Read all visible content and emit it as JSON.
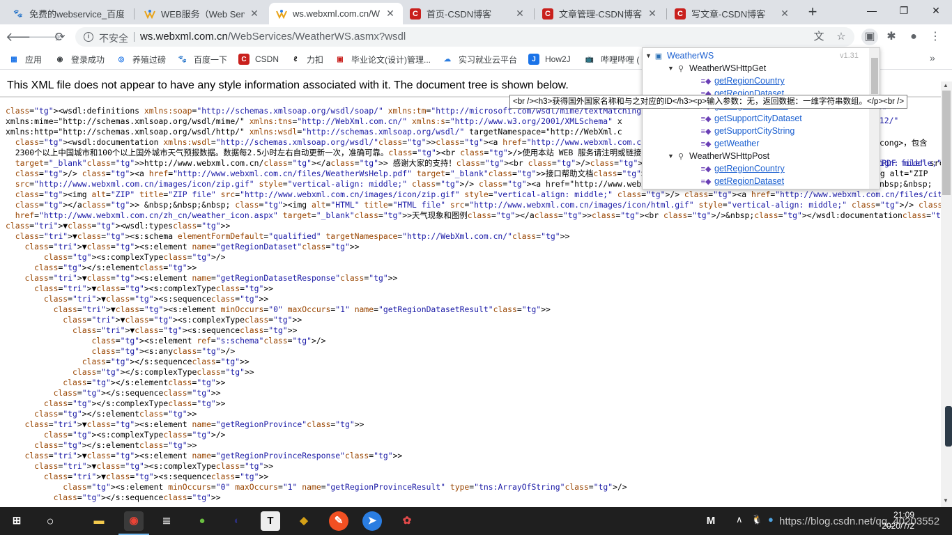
{
  "tabs": [
    {
      "label": "免费的webservice_百度",
      "icon": "baidu-paw-icon",
      "active": false
    },
    {
      "label": "WEB服务（Web Servic",
      "icon": "webxml-icon",
      "active": false
    },
    {
      "label": "ws.webxml.com.cn/W",
      "icon": "webxml-icon",
      "active": true
    },
    {
      "label": "首页-CSDN博客",
      "icon": "csdn-icon",
      "active": false
    },
    {
      "label": "文章管理-CSDN博客",
      "icon": "csdn-icon",
      "active": false
    },
    {
      "label": "写文章-CSDN博客",
      "icon": "csdn-icon",
      "active": false
    }
  ],
  "newtab": "+",
  "window": {
    "minimize": "—",
    "restore": "❐",
    "close": "✕"
  },
  "toolbar": {
    "security_label": "不安全",
    "url_host": "ws.webxml.com.cn",
    "url_path": "/WebServices/WeatherWS.asmx?wsdl"
  },
  "bookmarks": [
    {
      "label": "应用",
      "icon": "apps-grid-icon"
    },
    {
      "label": "登录成功",
      "icon": "globe-icon"
    },
    {
      "label": "养殖过磅",
      "icon": "chrome-icon"
    },
    {
      "label": "百度一下",
      "icon": "baidu-paw-icon"
    },
    {
      "label": "CSDN",
      "icon": "csdn-icon"
    },
    {
      "label": "力扣",
      "icon": "leetcode-icon"
    },
    {
      "label": "毕业论文(设计)管理...",
      "icon": "paper-icon"
    },
    {
      "label": "实习就业云平台",
      "icon": "cloud-icon"
    },
    {
      "label": "How2J",
      "icon": "how2j-icon"
    },
    {
      "label": "哔哩哔哩 (",
      "icon": "bilibili-icon"
    }
  ],
  "notice": "This XML file does not appear to have any style information associated with it. The document tree is shown below.",
  "xml_lines": [
    "<wsdl:definitions xmlns:soap=\"http://schemas.xmlsoap.org/wsdl/soap/\" xmlns:tm=\"http://microsoft.com/wsdl/mime/textMatching/\" xmln",
    "xmlns:mime=\"http://schemas.xmlsoap.org/wsdl/mime/\" xmlns:tns=\"http://WebXml.com.cn/\" xmlns:s=\"http://www.w3.org/2001/XMLSchema\" x",
    "xmlns:http=\"http://schemas.xmlsoap.org/wsdl/http/\" xmlns:wsdl=\"http://schemas.xmlsoap.org/wsdl/\" targetNamespace=\"http://WebXml.c",
    "  <wsdl:documentation xmlns:wsdl=\"http://schemas.xmlsoap.org/wsdl/\"><a href=\"http://www.webxml.com.cn/\" target=\"_blank\">WebXml.co",
    "  2300个以上中国城市和100个以上国外城市天气预报数据。数据每2.5小时左右自动更新一次，准确可靠。<br />使用本站 WEB 服务请注明或链接",
    "  target=\"_blank\">http://www.webxml.com.cn/</a> 感谢大家的支持！<br /><br /><img alt=\"PDF\" title=\"PDF file\" src=\"http://www.webxm",
    "  /> <a href=\"http://www.webxml.com.cn/files/WeatherWsHelp.pdf\" target=\"_blank\">接口帮助文档</a> &nbsp;&nbsp;&nbsp; <img alt=\"ZIP",
    "  src=\"http://www.webxml.com.cn/images/icon/zip.gif\" style=\"vertical-align: middle;\" /> <a href=\"http://www.webxml.com.cn/files/a",
    "  <img alt=\"ZIP\" title=\"ZIP file\" src=\"http://www.webxml.com.cn/images/icon/zip.gif\" style=\"vertical-align: middle;\" /> <a href=\"http://www.webxml.com.cn/files/city_photo.zip\">部分城市图片",
    "  </a> &nbsp;&nbsp;&nbsp; <img alt=\"HTML\" title=\"HTML file\" src=\"http://www.webxml.com.cn/images/icon/html.gif\" style=\"vertical-align: middle;\" /> <a",
    "  href=\"http://www.webxml.com.cn/zh_cn/weather_icon.aspx\" target=\"_blank\">天气现象和图例</a><br />&nbsp;</wsdl:documentation>",
    "▼<wsdl:types>",
    "  ▼<s:schema elementFormDefault=\"qualified\" targetNamespace=\"http://WebXml.com.cn/\">",
    "    ▼<s:element name=\"getRegionDataset\">",
    "        <s:complexType/>",
    "      </s:element>",
    "    ▼<s:element name=\"getRegionDatasetResponse\">",
    "      ▼<s:complexType>",
    "        ▼<s:sequence>",
    "          ▼<s:element minOccurs=\"0\" maxOccurs=\"1\" name=\"getRegionDatasetResult\">",
    "            ▼<s:complexType>",
    "              ▼<s:sequence>",
    "                  <s:element ref=\"s:schema\"/>",
    "                  <s:any/>",
    "                </s:sequence>",
    "              </s:complexType>",
    "            </s:element>",
    "          </s:sequence>",
    "        </s:complexType>",
    "      </s:element>",
    "    ▼<s:element name=\"getRegionProvince\">",
    "        <s:complexType/>",
    "      </s:element>",
    "    ▼<s:element name=\"getRegionProvinceResponse\">",
    "      ▼<s:complexType>",
    "        ▼<s:sequence>",
    "            <s:element minOccurs=\"0\" maxOccurs=\"1\" name=\"getRegionProvinceResult\" type=\"tns:ArrayOfString\"/>",
    "          </s:sequence>"
  ],
  "xml_right_fragments": {
    "line1": "ng/\"",
    "line2": "p12/\"",
    "line4": "cong>，包含",
    "line6": "ign: middle;\"",
    "line8": "nbsp;&nbsp;"
  },
  "popup": {
    "version": "v1.31",
    "root": "WeatherWS",
    "groups": [
      {
        "name": "WeatherWSHttpGet",
        "items": [
          "getRegionCountry",
          "getRegionDataset",
          "getRegionProvince",
          "getSupportCityDataset",
          "getSupportCityString",
          "getWeather"
        ]
      },
      {
        "name": "WeatherWSHttpPost",
        "items": [
          "getRegionCountry",
          "getRegionDataset"
        ]
      }
    ]
  },
  "tooltip": "<br /><h3>获得国外国家名称和与之对应的ID</h3><p>输入参数：无，返回数据：一维字符串数组。</p><br />",
  "taskbar": {
    "clock_time": "21:09",
    "clock_date": "2020/7/2",
    "ime": "M",
    "watermark": "https://blog.csdn.net/qq_40203552"
  },
  "colors": {
    "tag": "#881280",
    "attr_name": "#994500",
    "attr_value": "#1a1aa6",
    "link": "#1a5fd0",
    "csdn_red": "#c9201d"
  }
}
